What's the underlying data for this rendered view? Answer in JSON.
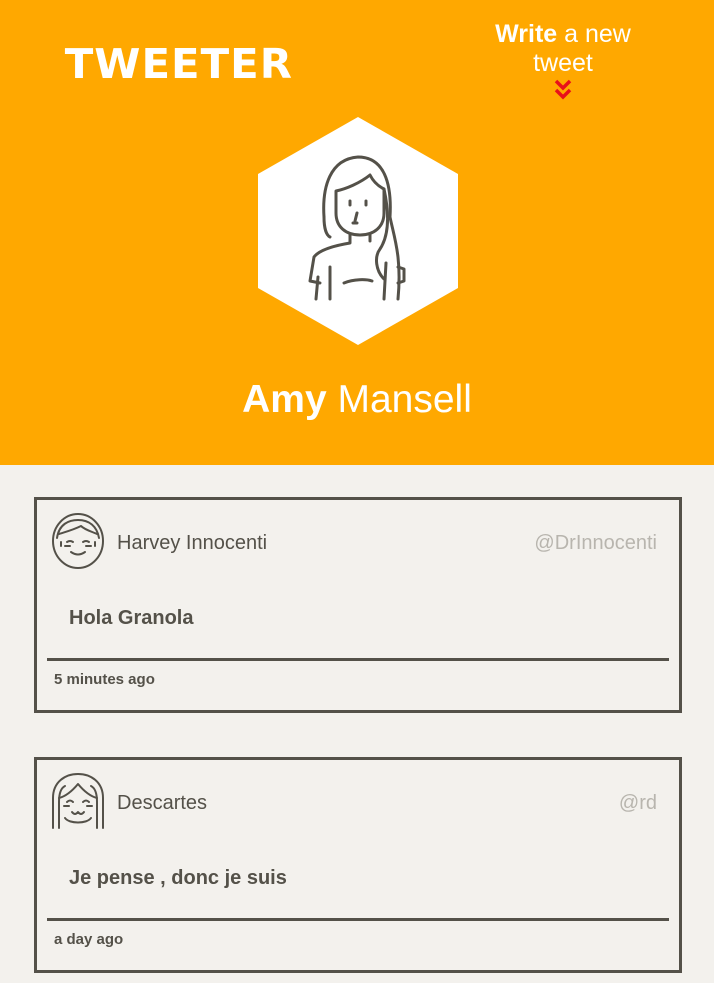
{
  "header": {
    "brand": "TWEETER",
    "compose": {
      "bold": "Write",
      "light": " a new tweet"
    },
    "profile": {
      "first_name": "Amy",
      "last_name": " Mansell"
    }
  },
  "colors": {
    "accent": "#ffa800",
    "text": "#545149",
    "chevron": "#e8101a"
  },
  "tweets": [
    {
      "name": "Harvey Innocenti",
      "handle": "@DrInnocenti",
      "content": "Hola Granola",
      "time": "5 minutes ago",
      "avatar_icon": "smiling-man-avatar-icon"
    },
    {
      "name": "Descartes",
      "handle": "@rd",
      "content": "Je pense , donc je suis",
      "time": "a day ago",
      "avatar_icon": "smiling-woman-avatar-icon"
    }
  ]
}
